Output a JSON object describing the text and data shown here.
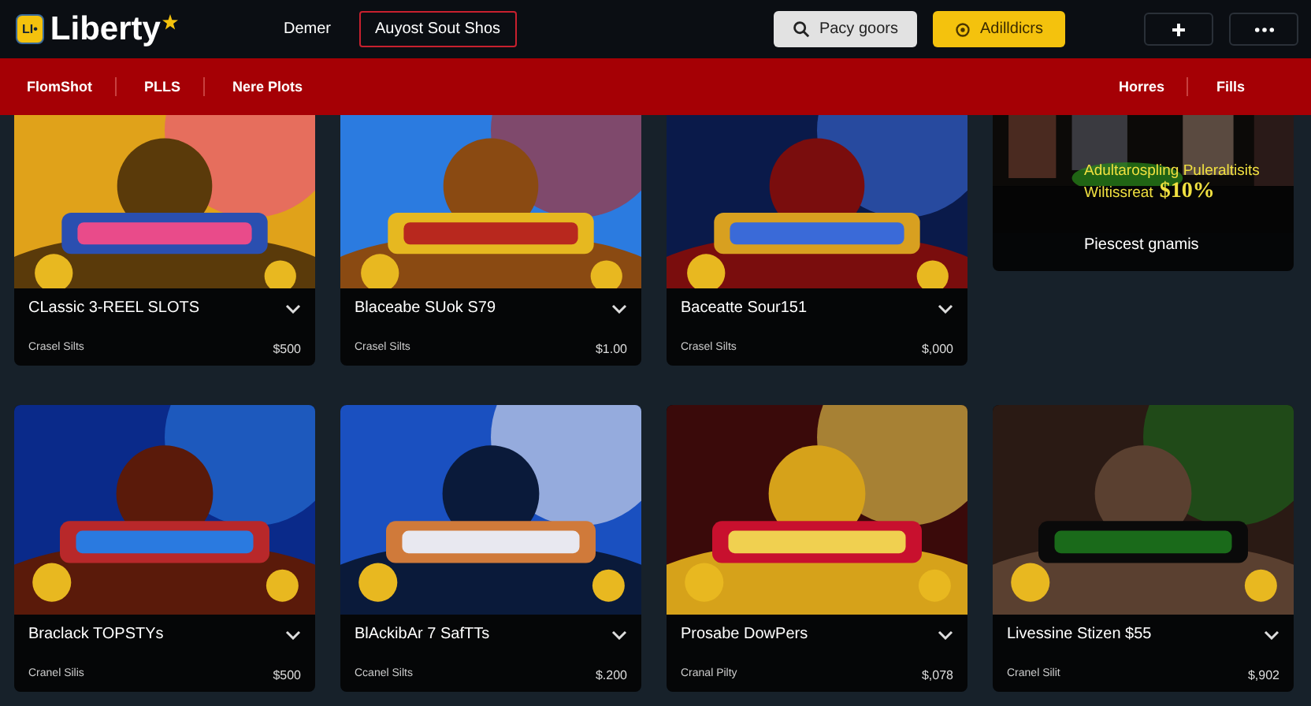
{
  "header": {
    "logo_badge": "LI•",
    "brand": "Liberty",
    "nav": [
      {
        "label": "Demer",
        "selected": false
      },
      {
        "label": "Auyost Sout Shos",
        "selected": true
      }
    ],
    "search_button": "Pacy goors",
    "account_button": "Adilldicrs"
  },
  "subnav": {
    "left": [
      "FlomShot",
      "PLLS",
      "Nere Plots"
    ],
    "right": [
      "Horres",
      "Fills"
    ]
  },
  "promo": {
    "headline": "Adultarospling Puleraltisits",
    "offer_label": "Wiltissreat",
    "offer_value": "$10%",
    "caption": "Piescest gnamis"
  },
  "rows": [
    [
      {
        "title": "CLassic 3-REEL SLOTS",
        "subtitle": "Crasel Silts",
        "price": "$500"
      },
      {
        "title": "Blaceabe SUok S79",
        "subtitle": "Crasel Silts",
        "price": "$1.00"
      },
      {
        "title": "Baceatte Sour151",
        "subtitle": "Crasel Silts",
        "price": "$,000"
      }
    ],
    [
      {
        "title": "Braclack TOPSTYs",
        "subtitle": "Cranel Silis",
        "price": "$500"
      },
      {
        "title": "BlAckibAr 7 SafTTs",
        "subtitle": "Ccanel Silts",
        "price": "$.200"
      },
      {
        "title": "Prosabe DowPers",
        "subtitle": "Cranal Pilty",
        "price": "$,078"
      },
      {
        "title": "Livessine Stizen $55",
        "subtitle": "Cranel Silit",
        "price": "$,902"
      }
    ]
  ]
}
